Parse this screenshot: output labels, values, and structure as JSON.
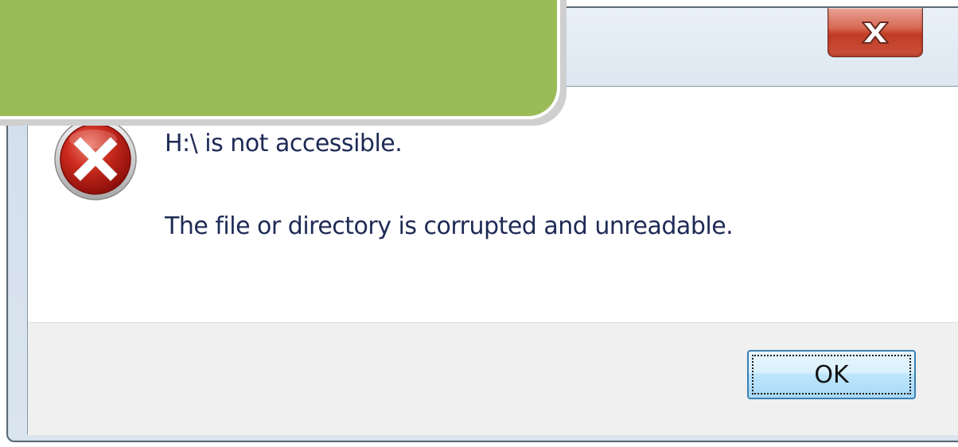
{
  "dialog": {
    "title": "",
    "close_button": {
      "icon": "close-icon",
      "color": "#c9513b"
    },
    "icon": "error-icon",
    "message_title": "H:\\ is not accessible.",
    "message_detail": "The file or directory is corrupted and unreadable.",
    "ok_button_label": "OK"
  },
  "callout": {
    "color": "#9bbb59"
  }
}
